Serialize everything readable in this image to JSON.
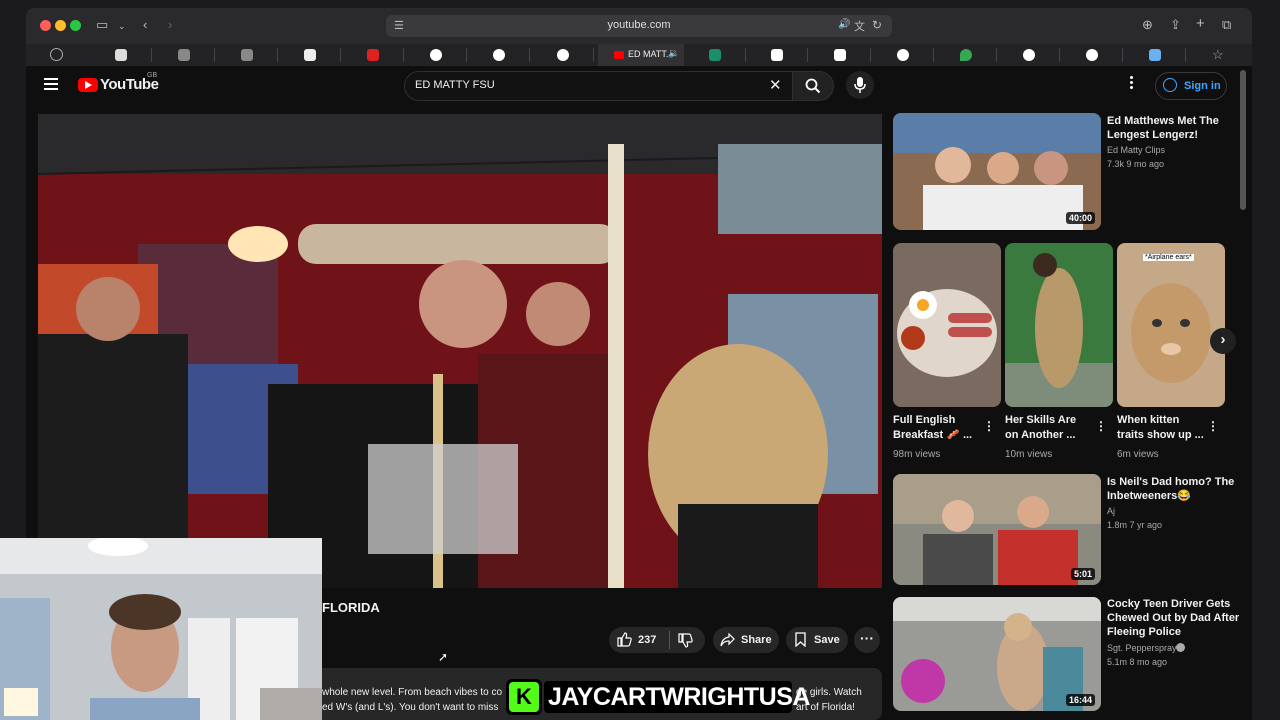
{
  "browser": {
    "address": "youtube.com",
    "active_tab_label": "ED MATT..."
  },
  "youtube": {
    "logo_text": "YouTube",
    "region": "GB",
    "search_query": "ED MATTY FSU",
    "sign_in_label": "Sign in"
  },
  "video": {
    "title_fragment": "FLORIDA",
    "likes": "237",
    "share_label": "Share",
    "save_label": "Save",
    "desc_line1_a": "whole new level. From beach vibes to co",
    "desc_line1_b": "ge girls. Watch",
    "desc_line2_a": "ed W's (and L's). You don't want to miss",
    "desc_line2_b": "art of Florida!"
  },
  "sidebar": {
    "videos": [
      {
        "title_l1": "Ed Matthews Met The",
        "title_l2": "Lengest Lengerz!",
        "channel": "Ed Matty Clips",
        "meta": "7.3k  9 mo ago",
        "duration": "40:00"
      },
      {
        "title_l1": "Is Neil's Dad homo? The",
        "title_l2": "Inbetweeners😂",
        "channel": "Aj",
        "meta": "1.8m  7 yr ago",
        "duration": "5:01"
      },
      {
        "title_l1": "Cocky Teen Driver Gets",
        "title_l2": "Chewed Out by Dad After",
        "title_l3": "Fleeing Police",
        "channel": "Sgt. Pepperspray",
        "meta": "5.1m  8 mo ago",
        "duration": "16:44"
      }
    ],
    "shorts": [
      {
        "title_l1": "Full English",
        "title_l2": "Breakfast 🥓 ...",
        "views": "98m views"
      },
      {
        "title_l1": "Her Skills Are",
        "title_l2": "on Another ...",
        "views": "10m views"
      },
      {
        "title_l1": "When kitten",
        "title_l2": "traits show up ...",
        "views": "6m views",
        "caption": "*Airplane ears*"
      }
    ]
  },
  "overlay": {
    "sticker_letter": "K",
    "sticker_text": "JAYCARTWRIGHTUSA"
  },
  "colors": {
    "yt_red": "#ff0000",
    "accent_blue": "#3ea6ff",
    "kick_green": "#53fc18"
  }
}
